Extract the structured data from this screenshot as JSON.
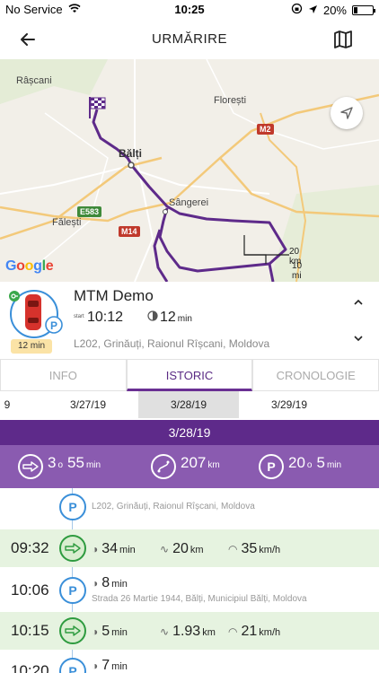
{
  "status_bar": {
    "carrier": "No Service",
    "time": "10:25",
    "battery": "20%",
    "battery_level": 0.2
  },
  "header": {
    "title": "URMĂRIRE"
  },
  "map": {
    "places": [
      "Râșcani",
      "Florești",
      "Bălți",
      "Sângerei",
      "Fălești"
    ],
    "roads": [
      "E583",
      "M14",
      "M2"
    ],
    "scale_km": "20 km",
    "scale_mi": "10 mi",
    "attribution": "Google",
    "colors": {
      "route": "#5e2a8a",
      "land": "#f2efe8",
      "road": "#f3c97a"
    }
  },
  "vehicle": {
    "name": "MTM Demo",
    "start_label": "start",
    "start_time": "10:12",
    "duration_value": "12",
    "duration_unit": "min",
    "address": "L202, Grinăuți, Raionul Rîșcani, Moldova",
    "badge": "12 min",
    "parking_letter": "P"
  },
  "tabs": [
    {
      "label": "INFO",
      "active": false
    },
    {
      "label": "ISTORIC",
      "active": true
    },
    {
      "label": "CRONOLOGIE",
      "active": false
    }
  ],
  "dates": [
    "9",
    "3/27/19",
    "3/28/19",
    "3/29/19"
  ],
  "selected_date": "3/28/19",
  "summary": {
    "drive_hours": "3",
    "drive_hours_unit": "o",
    "drive_minutes": "55",
    "drive_minutes_unit": "min",
    "distance": "207",
    "distance_unit": "km",
    "park_hours": "20",
    "park_hours_unit": "o",
    "park_minutes": "5",
    "park_minutes_unit": "min",
    "parking_letter": "P"
  },
  "timeline": {
    "parking_letter": "P",
    "rows": [
      {
        "type": "park",
        "time": "",
        "address": "L202, Grinăuți, Raionul Rîșcani, Moldova"
      },
      {
        "type": "move",
        "time": "09:32",
        "duration": "34",
        "duration_unit": "min",
        "distance": "20",
        "distance_unit": "km",
        "speed": "35",
        "speed_unit": "km/h"
      },
      {
        "type": "park",
        "time": "10:06",
        "duration": "8",
        "duration_unit": "min",
        "address": "Strada 26 Martie 1944, Bălți, Municipiul Bălți, Moldova"
      },
      {
        "type": "move",
        "time": "10:15",
        "duration": "5",
        "duration_unit": "min",
        "distance": "1.93",
        "distance_unit": "km",
        "speed": "21",
        "speed_unit": "km/h"
      },
      {
        "type": "park",
        "time": "10:20",
        "duration": "7",
        "duration_unit": "min"
      }
    ]
  }
}
